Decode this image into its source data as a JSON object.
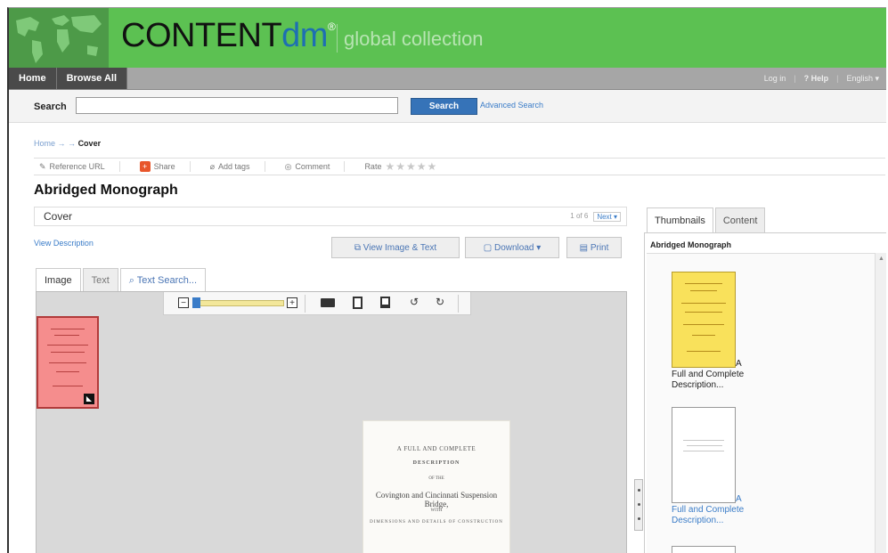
{
  "header": {
    "brand_main": "CONTENT",
    "brand_dm": "dm",
    "brand_mark": "®",
    "collection": "global collection"
  },
  "nav": {
    "left": [
      "Home",
      "Browse All"
    ],
    "login": "Log in",
    "help": "? Help",
    "language": "English ▾"
  },
  "search": {
    "label": "Search",
    "value": "",
    "button": "Search",
    "advanced": "Advanced Search"
  },
  "breadcrumb": {
    "home": "Home",
    "separators": "→ →",
    "current": "Cover"
  },
  "actions": {
    "reference": "Reference URL",
    "share": "Share",
    "tags": "Add tags",
    "comment": "Comment",
    "rate": "Rate",
    "stars": "★★★★★"
  },
  "item": {
    "title": "Abridged Monograph",
    "page_label": "Cover",
    "pager": "1 of 6",
    "next": "Next ▾",
    "view_description": "View Description"
  },
  "buttons": {
    "view_image_text": "View Image & Text",
    "download": "Download ▾",
    "print": "Print"
  },
  "viewer_tabs": [
    "Image",
    "Text",
    "Text Search..."
  ],
  "document": {
    "line1": "A FULL AND COMPLETE",
    "line2": "DESCRIPTION",
    "line3": "OF THE",
    "line4": "Covington and Cincinnati Suspension Bridge,",
    "line5": "WITH",
    "line6": "DIMENSIONS AND DETAILS OF CONSTRUCTION"
  },
  "right_panel": {
    "tabs": [
      "Thumbnails",
      "Content"
    ],
    "title": "Abridged Monograph",
    "items": [
      {
        "caption_a": "A",
        "caption": "Full and Complete Description..."
      },
      {
        "caption_a": "A",
        "caption": "Full and Complete Description..."
      }
    ]
  },
  "colors": {
    "header_green": "#5cc152",
    "link_blue": "#3a7cc8",
    "search_button": "#3673b8",
    "thumb_highlight": "#f9e15b",
    "nav_highlight": "#f58d8d"
  }
}
